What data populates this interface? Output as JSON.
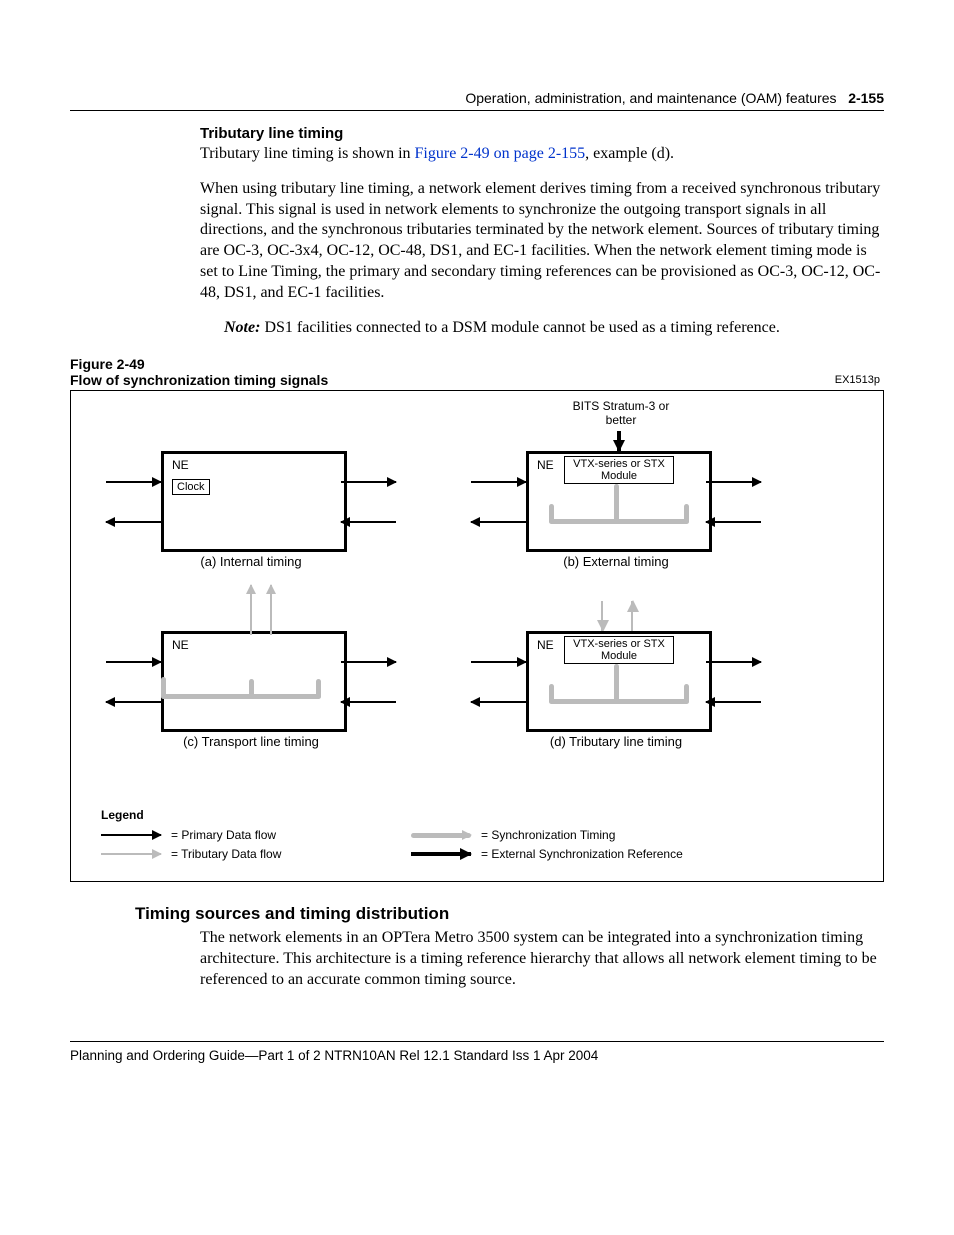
{
  "header": {
    "section": "Operation, administration, and maintenance (OAM) features",
    "page": "2-155"
  },
  "sub1": {
    "title": "Tributary line timing",
    "p1a": "Tributary line timing is shown in ",
    "link": "Figure 2-49 on page 2-155",
    "p1b": ", example (d).",
    "p2": "When using tributary line timing, a network element derives timing from a received synchronous tributary signal. This signal is used in network elements to synchronize the outgoing transport signals in all directions, and the synchronous tributaries terminated by the network element. Sources of tributary timing are OC-3, OC-3x4, OC-12, OC-48, DS1, and EC-1 facilities. When the network element timing mode is set to Line Timing, the primary and secondary timing references can be provisioned as OC-3, OC-12, OC-48, DS1, and EC-1 facilities.",
    "note_label": "Note:",
    "note_text": "  DS1 facilities connected to a DSM module cannot be used as a timing reference."
  },
  "figure": {
    "num": "Figure 2-49",
    "title": "Flow of synchronization timing signals",
    "code": "EX1513p",
    "bits": "BITS Stratum-3 or better",
    "ne": "NE",
    "clock": "Clock",
    "module": "VTX-series or STX Module",
    "cap_a": "(a) Internal timing",
    "cap_b": "(b) External timing",
    "cap_c": "(c) Transport line timing",
    "cap_d": "(d) Tributary line timing",
    "legend_title": "Legend",
    "leg1": "= Primary Data flow",
    "leg2": "= Tributary Data flow",
    "leg3": "= Synchronization Timing",
    "leg4": "= External Synchronization Reference"
  },
  "section2": {
    "title": "Timing sources and timing distribution",
    "p1": "The network elements in an OPTera Metro 3500 system can be integrated into a synchronization timing architecture. This architecture is a timing reference hierarchy that allows all network element timing to be referenced to an accurate common timing source."
  },
  "footer": "Planning and Ordering Guide—Part 1 of 2   NTRN10AN   Rel 12.1  Standard   Iss 1   Apr 2004"
}
